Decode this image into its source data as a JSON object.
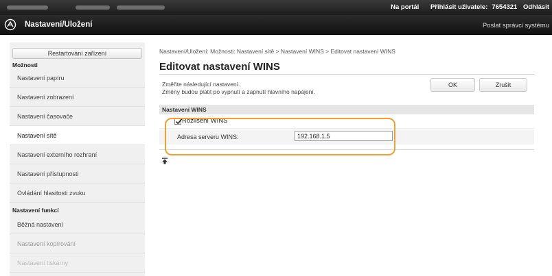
{
  "top_bar": {
    "portal_link": "Na portál",
    "login_label": "Přihlásit uživatele:",
    "user_id": "7654321",
    "logout_link": "Odhlásit"
  },
  "app_bar": {
    "title": "Nastavení/Uložení",
    "send_link": "Poslat správci systému"
  },
  "sidebar": {
    "restart_button": "Restartování zařízení",
    "heading_options": "Možnosti",
    "items": [
      {
        "label": "Nastavení papíru"
      },
      {
        "label": "Nastavení zobrazení"
      },
      {
        "label": "Nastavení časovače"
      },
      {
        "label": "Nastavení sítě"
      },
      {
        "label": "Nastavení externího rozhraní"
      },
      {
        "label": "Nastavení přístupnosti"
      },
      {
        "label": "Ovládání hlasitosti zvuku"
      }
    ],
    "heading_functions": "Nastavení funkcí",
    "function_items": [
      {
        "label": "Běžná nastavení"
      },
      {
        "label": "Nastavení kopírování"
      },
      {
        "label": "Nastavení tiskárny"
      }
    ]
  },
  "main": {
    "breadcrumb": "Nastavení/Uložení: Možnosti: Nastavení sítě > Nastavení WINS > Editovat nastavení WINS",
    "title": "Editovat nastavení WINS",
    "instruction_line1": "Změňte následující nastavení.",
    "instruction_line2": "Změny budou platit po vypnutí a zapnutí hlavního napájení.",
    "ok_button": "OK",
    "cancel_button": "Zrušit",
    "section_title": "Nastavení WINS",
    "wins_resolution_label": "Rozlišení WINS",
    "wins_resolution_checked": true,
    "server_address_label": "Adresa serveru WINS:",
    "server_address_value": "192.168.1.5"
  },
  "colors": {
    "highlight": "#f0a030",
    "topbar": "#1c1c1c",
    "sidebar_bg": "#f0f0f0"
  }
}
